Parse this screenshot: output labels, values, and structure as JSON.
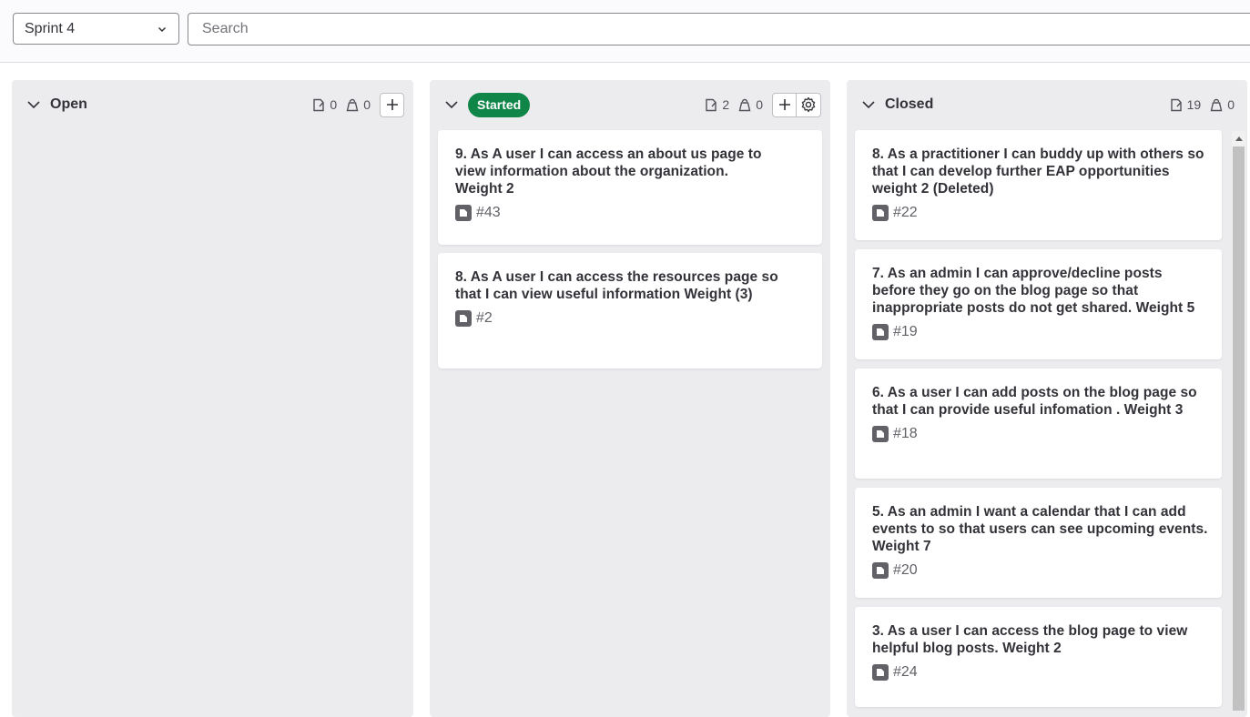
{
  "filters": {
    "sprint_value": "Sprint 4",
    "search_placeholder": "Search"
  },
  "columns": {
    "open": {
      "title": "Open",
      "issue_count": "0",
      "weight_count": "0"
    },
    "started": {
      "label": "Started",
      "label_color": "#108548",
      "issue_count": "2",
      "weight_count": "0",
      "cards": [
        {
          "title": "9. As A user I can access an about us page to view information about the organization. Weight 2",
          "ref": "#43"
        },
        {
          "title": "8. As A user I can access the resources page so that I can view useful information Weight (3)",
          "ref": "#2"
        }
      ]
    },
    "closed": {
      "title": "Closed",
      "issue_count": "19",
      "weight_count": "0",
      "cards": [
        {
          "title": "8. As a practitioner I can buddy up with others so that I can develop further EAP opportunities weight 2 (Deleted)",
          "ref": "#22"
        },
        {
          "title": "7. As an admin I can approve/decline posts before they go on the blog page so that inappropriate posts do not get shared. Weight 5",
          "ref": "#19"
        },
        {
          "title": "6. As a user I can add posts on the blog page so that I can provide useful infomation . Weight 3",
          "ref": "#18"
        },
        {
          "title": "5. As an admin I want a calendar that I can add events to so that users can see upcoming events. Weight 7",
          "ref": "#20"
        },
        {
          "title": "3. As a user I can access the blog page to view helpful blog posts. Weight 2",
          "ref": "#24"
        }
      ]
    }
  },
  "icons": {
    "collapse": "chevron-down-icon",
    "issues": "issues-icon",
    "weight": "weight-icon",
    "add": "plus-icon",
    "settings": "gear-icon",
    "issue_type": "issue-type-icon"
  }
}
